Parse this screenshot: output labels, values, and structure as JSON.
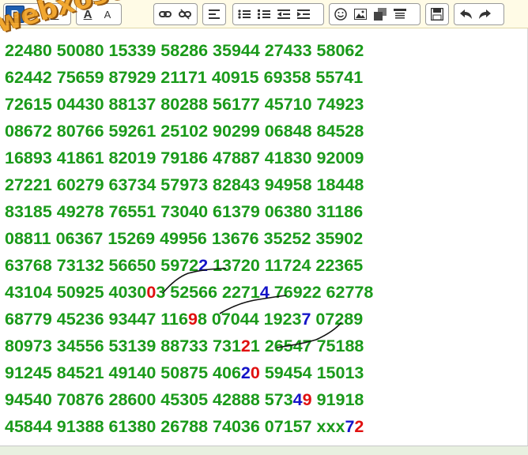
{
  "toolbar": {
    "groups": [
      {
        "buttons": [
          "bold",
          "italic",
          "underline"
        ]
      },
      {
        "buttons": [
          "font-color",
          "font-size"
        ]
      },
      {
        "buttons": [
          "link",
          "unlink"
        ]
      },
      {
        "buttons": [
          "align"
        ]
      },
      {
        "buttons": [
          "bullet-list",
          "numbered-list",
          "outdent",
          "indent"
        ]
      },
      {
        "buttons": [
          "emoticon",
          "image",
          "media",
          "quote"
        ]
      },
      {
        "buttons": [
          "save"
        ]
      },
      {
        "buttons": [
          "undo",
          "redo"
        ]
      }
    ],
    "bold_label": "B",
    "italic_label": "I",
    "underline_label": "U",
    "font_color_label": "A",
    "font_size_label": "A"
  },
  "watermark": "webxoso.net",
  "lines": [
    {
      "segments": [
        {
          "t": "22480 50080 15339 58286 35944 27433 58062"
        }
      ]
    },
    {
      "segments": [
        {
          "t": "62442 75659 87929 21171 40915 69358 55741"
        }
      ]
    },
    {
      "segments": [
        {
          "t": "72615 04430 88137 80288 56177 45710 74923"
        }
      ]
    },
    {
      "segments": [
        {
          "t": "08672 80766 59261 25102 90299 06848 84528"
        }
      ]
    },
    {
      "segments": [
        {
          "t": "16893 41861 82019 79186 47887 41830 92009"
        }
      ]
    },
    {
      "segments": [
        {
          "t": "27221 60279 63734 57973 82843 94958 18448"
        }
      ]
    },
    {
      "segments": [
        {
          "t": "83185 49278 76551 73040 61379 06380 31186"
        }
      ]
    },
    {
      "segments": [
        {
          "t": "08811 06367 15269 49956 13676 35252 35902"
        }
      ]
    },
    {
      "segments": [
        {
          "t": "63768 73132 56650 5972"
        },
        {
          "t": "2",
          "c": "blue"
        },
        {
          "t": " 13720 11724 22365"
        }
      ]
    },
    {
      "segments": [
        {
          "t": "43104 50925 4030"
        },
        {
          "t": "0",
          "c": "red"
        },
        {
          "t": "3 52566 2271"
        },
        {
          "t": "4",
          "c": "blue"
        },
        {
          "t": " 76922 62778"
        }
      ]
    },
    {
      "segments": [
        {
          "t": "68779 45236 93447 116"
        },
        {
          "t": "9",
          "c": "red"
        },
        {
          "t": "8 07044 1923"
        },
        {
          "t": "7",
          "c": "blue"
        },
        {
          "t": " 07289"
        }
      ]
    },
    {
      "segments": [
        {
          "t": "80973 34556 53139 88733 731"
        },
        {
          "t": "2",
          "c": "red"
        },
        {
          "t": "1 26547 75188"
        }
      ]
    },
    {
      "segments": [
        {
          "t": "91245 84521 49140 50875 406"
        },
        {
          "t": "2",
          "c": "blue"
        },
        {
          "t": "0",
          "c": "red"
        },
        {
          "t": " 59454 15013"
        }
      ]
    },
    {
      "segments": [
        {
          "t": "94540 70876 28600 45305 42888 573"
        },
        {
          "t": "4",
          "c": "blue"
        },
        {
          "t": "9",
          "c": "red"
        },
        {
          "t": " 91918"
        }
      ]
    },
    {
      "segments": [
        {
          "t": "45844 91388 61380 26788 74036 07157 xxx"
        },
        {
          "t": "7",
          "c": "blue"
        },
        {
          "t": "2",
          "c": "red"
        }
      ]
    }
  ],
  "colors": {
    "number_green": "#1a9a1a",
    "highlight_blue": "#1414c8",
    "highlight_red": "#e01010",
    "active_button": "#1f5fb0"
  }
}
